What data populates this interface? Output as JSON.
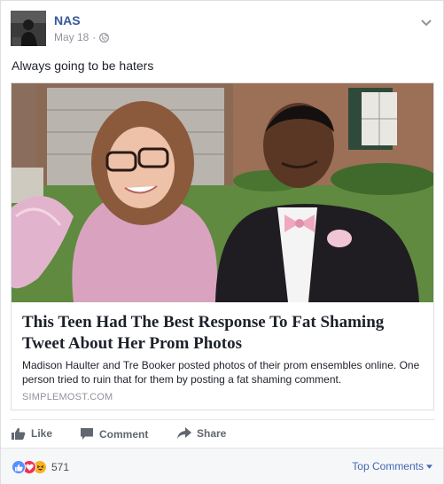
{
  "post": {
    "author": "NAS",
    "date": "May 18",
    "separator": "·",
    "privacy_icon": "globe-icon",
    "text": "Always going to be haters"
  },
  "link": {
    "title": "This Teen Had The Best Response To Fat Shaming Tweet About Her Prom Photos",
    "description": "Madison Haulter and Tre Booker posted photos of their prom ensembles online. One person tried to ruin that for them by posting a fat shaming comment.",
    "domain": "SIMPLEMOST.COM"
  },
  "actions": {
    "like": "Like",
    "comment": "Comment",
    "share": "Share"
  },
  "footer": {
    "reaction_icons": [
      "like-reaction-icon",
      "love-reaction-icon",
      "haha-reaction-icon"
    ],
    "reaction_count": "571",
    "top_comments": "Top Comments"
  },
  "colors": {
    "author_link": "#365899",
    "accent": "#4267b2",
    "muted": "#90949c",
    "like_reaction": "#5890ff",
    "love_reaction": "#f0314d",
    "haha_reaction": "#f7b125"
  }
}
